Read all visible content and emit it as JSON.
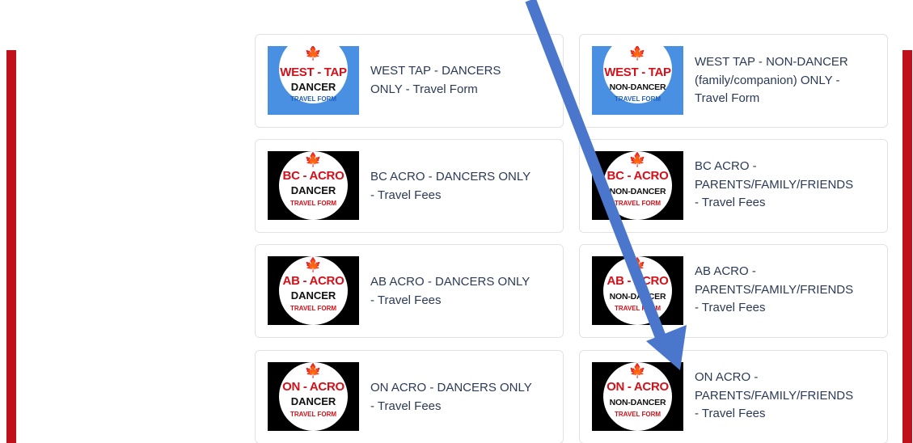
{
  "colors": {
    "page_border_red": "#c0101a",
    "maple_red": "#d3111a",
    "west_tap_thumb_bg": "#4a90e2",
    "acro_thumb_bg": "#000000",
    "tap_travel_form_text": "#1f5fbf",
    "acro_travel_form_text": "#d3111a",
    "card_text": "#2b3a55",
    "annotation_arrow": "#4a76cc"
  },
  "cards": [
    {
      "thumb": {
        "icon": "maple-leaf-icon",
        "leaf": "🍁",
        "title": "WEST - TAP",
        "subtitle": "DANCER",
        "tag": "TRAVEL FORM"
      },
      "text": "WEST TAP - DANCERS ONLY - Travel Form"
    },
    {
      "thumb": {
        "icon": "maple-leaf-icon",
        "leaf": "🍁",
        "title": "WEST - TAP",
        "subtitle": "NON-DANCER",
        "tag": "TRAVEL FORM"
      },
      "text": "WEST TAP - NON-DANCER (family/companion) ONLY - Travel Form"
    },
    {
      "thumb": {
        "icon": "maple-leaf-icon",
        "leaf": "🍁",
        "title": "BC - ACRO",
        "subtitle": "DANCER",
        "tag": "TRAVEL FORM"
      },
      "text": "BC ACRO - DANCERS ONLY - Travel Fees"
    },
    {
      "thumb": {
        "icon": "maple-leaf-icon",
        "leaf": "🍁",
        "title": "BC - ACRO",
        "subtitle": "NON-DANCER",
        "tag": "TRAVEL FORM"
      },
      "text": "BC ACRO - PARENTS/FAMILY/FRIENDS - Travel Fees"
    },
    {
      "thumb": {
        "icon": "maple-leaf-icon",
        "leaf": "🍁",
        "title": "AB - ACRO",
        "subtitle": "DANCER",
        "tag": "TRAVEL FORM"
      },
      "text": "AB ACRO - DANCERS ONLY - Travel Fees"
    },
    {
      "thumb": {
        "icon": "maple-leaf-icon",
        "leaf": "🍁",
        "title": "AB - ACRO",
        "subtitle": "NON-DANCER",
        "tag": "TRAVEL FORM"
      },
      "text": "AB ACRO - PARENTS/FAMILY/FRIENDS - Travel Fees"
    },
    {
      "thumb": {
        "icon": "maple-leaf-icon",
        "leaf": "🍁",
        "title": "ON - ACRO",
        "subtitle": "DANCER",
        "tag": "TRAVEL FORM"
      },
      "text": "ON ACRO - DANCERS ONLY - Travel Fees"
    },
    {
      "thumb": {
        "icon": "maple-leaf-icon",
        "leaf": "🍁",
        "title": "ON - ACRO",
        "subtitle": "NON-DANCER",
        "tag": "TRAVEL FORM"
      },
      "text": "ON ACRO - PARENTS/FAMILY/FRIENDS - Travel Fees"
    }
  ]
}
